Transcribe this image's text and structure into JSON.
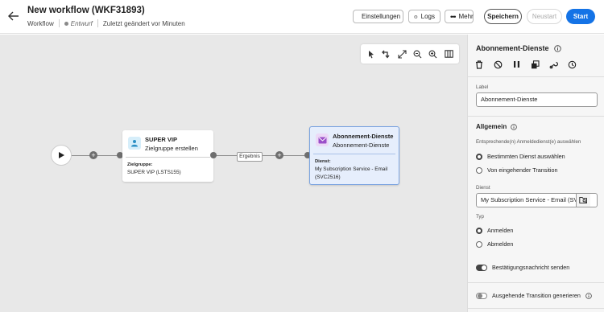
{
  "header": {
    "title": "New workflow (WKF31893)",
    "crumb_type": "Workflow",
    "status": "Entwurf",
    "last_modified": "Zuletzt geändert vor Minuten",
    "settings_label": "Einstellungen",
    "logs_label": "Logs",
    "more_label": "Mehr",
    "save_label": "Speichern",
    "restart_label": "Neustart",
    "start_label": "Start"
  },
  "canvas": {
    "edge_label": "Ergebnis",
    "node1": {
      "title": "SUPER VIP",
      "subtitle": "Zielgruppe erstellen",
      "detail_key": "Zielgruppe:",
      "detail_value": "SUPER VIP (LSTS155)"
    },
    "node2": {
      "title": "Abonnement-Dienste",
      "subtitle": "Abonnement-Dienste",
      "detail_key": "Dienst:",
      "detail_line1": "My Subscription Service - Email",
      "detail_line2": "(SVC2516)"
    }
  },
  "panel": {
    "title": "Abonnement-Dienste",
    "label_caption": "Label",
    "label_value": "Abonnement-Dienste",
    "section_general": "Allgemein",
    "source_caption": "Entsprechende(n) Anmeldedienst(e) auswählen",
    "source_options": [
      "Bestimmten Dienst auswählen",
      "Von eingehender Transition"
    ],
    "service_caption": "Dienst",
    "service_value": "My Subscription Service - Email  (SVC25",
    "type_caption": "Typ",
    "type_options": [
      "Anmelden",
      "Abmelden"
    ],
    "confirm_label": "Bestätigungsnachricht senden",
    "outgoing_label": "Ausgehende Transition generieren"
  },
  "colors": {
    "accent": "#1473e6",
    "canvas_bg": "#e8e8e8",
    "selected_node_bg": "#e6eefc",
    "selected_node_border": "#7aa3e0"
  }
}
